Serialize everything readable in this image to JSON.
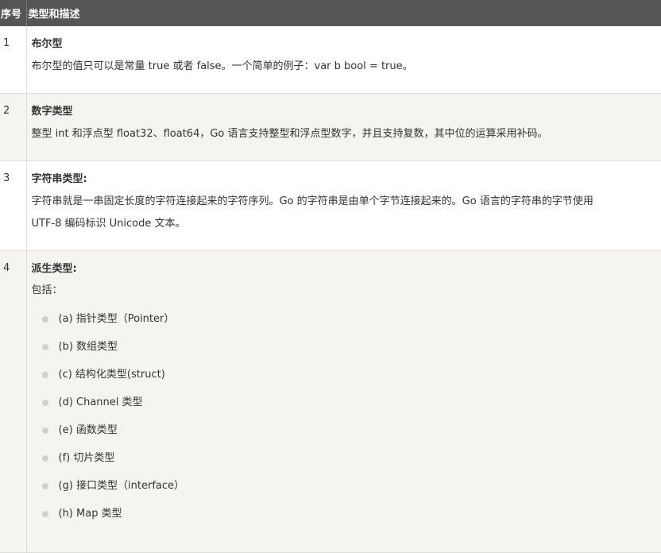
{
  "headers": {
    "index": "序号",
    "type_desc": "类型和描述"
  },
  "rows": [
    {
      "num": "1",
      "name": "布尔型",
      "desc": "布尔型的值只可以是常量 true 或者 false。一个简单的例子：var b bool = true。"
    },
    {
      "num": "2",
      "name": "数字类型",
      "desc": "整型 int 和浮点型 float32、float64，Go 语言支持整型和浮点型数字，并且支持复数，其中位的运算采用补码。"
    },
    {
      "num": "3",
      "name": "字符串类型:",
      "desc_line1": "字符串就是一串固定长度的字符连接起来的字符序列。Go 的字符串是由单个字节连接起来的。Go 语言的字符串的字节使用",
      "desc_line2": "UTF-8 编码标识 Unicode 文本。"
    },
    {
      "num": "4",
      "name": "派生类型:",
      "includes_label": "包括：",
      "items": [
        "(a) 指针类型（Pointer）",
        "(b) 数组类型",
        "(c) 结构化类型(struct)",
        "(d) Channel 类型",
        "(e) 函数类型",
        "(f) 切片类型",
        "(g) 接口类型（interface）",
        "(h) Map 类型"
      ]
    }
  ]
}
